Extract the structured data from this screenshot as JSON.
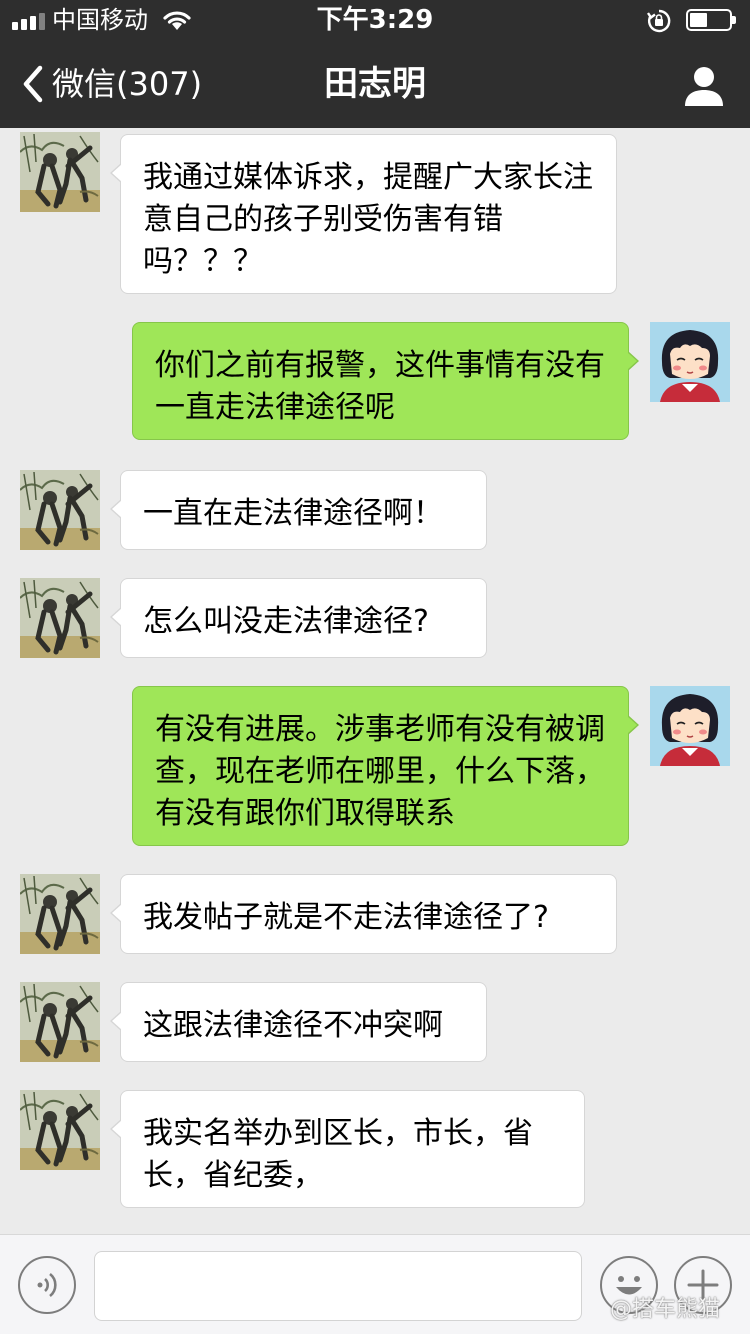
{
  "status_bar": {
    "carrier": "中国移动",
    "time": "下午3:29",
    "battery_level_percent": 45
  },
  "nav": {
    "back_label": "微信(307)",
    "title": "田志明",
    "back_icon": "chevron-left-icon",
    "profile_icon": "person-icon"
  },
  "messages": [
    {
      "side": "in",
      "text": "我通过媒体诉求，提醒广大家长注意自己的孩子别受伤害有错吗？？？"
    },
    {
      "side": "out",
      "text": "你们之前有报警，这件事情有没有一直走法律途径呢"
    },
    {
      "side": "in",
      "text": "一直在走法律途径啊！"
    },
    {
      "side": "in",
      "text": "怎么叫没走法律途径?"
    },
    {
      "side": "out",
      "text": "有没有进展。涉事老师有没有被调查，现在老师在哪里，什么下落，有没有跟你们取得联系"
    },
    {
      "side": "in",
      "text": "我发帖子就是不走法律途径了?"
    },
    {
      "side": "in",
      "text": "这跟法律途径不冲突啊"
    },
    {
      "side": "in",
      "text": "我实名举办到区长，市长，省长，省纪委，"
    }
  ],
  "input_bar": {
    "voice_icon": "voice-icon",
    "emoji_icon": "emoji-icon",
    "plus_icon": "plus-icon",
    "input_value": ""
  },
  "watermark": "@搭车熊猫",
  "colors": {
    "header_bg": "#2e2e2e",
    "chat_bg": "#ebebeb",
    "outgoing_bubble": "#9fe658",
    "incoming_bubble": "#ffffff"
  }
}
